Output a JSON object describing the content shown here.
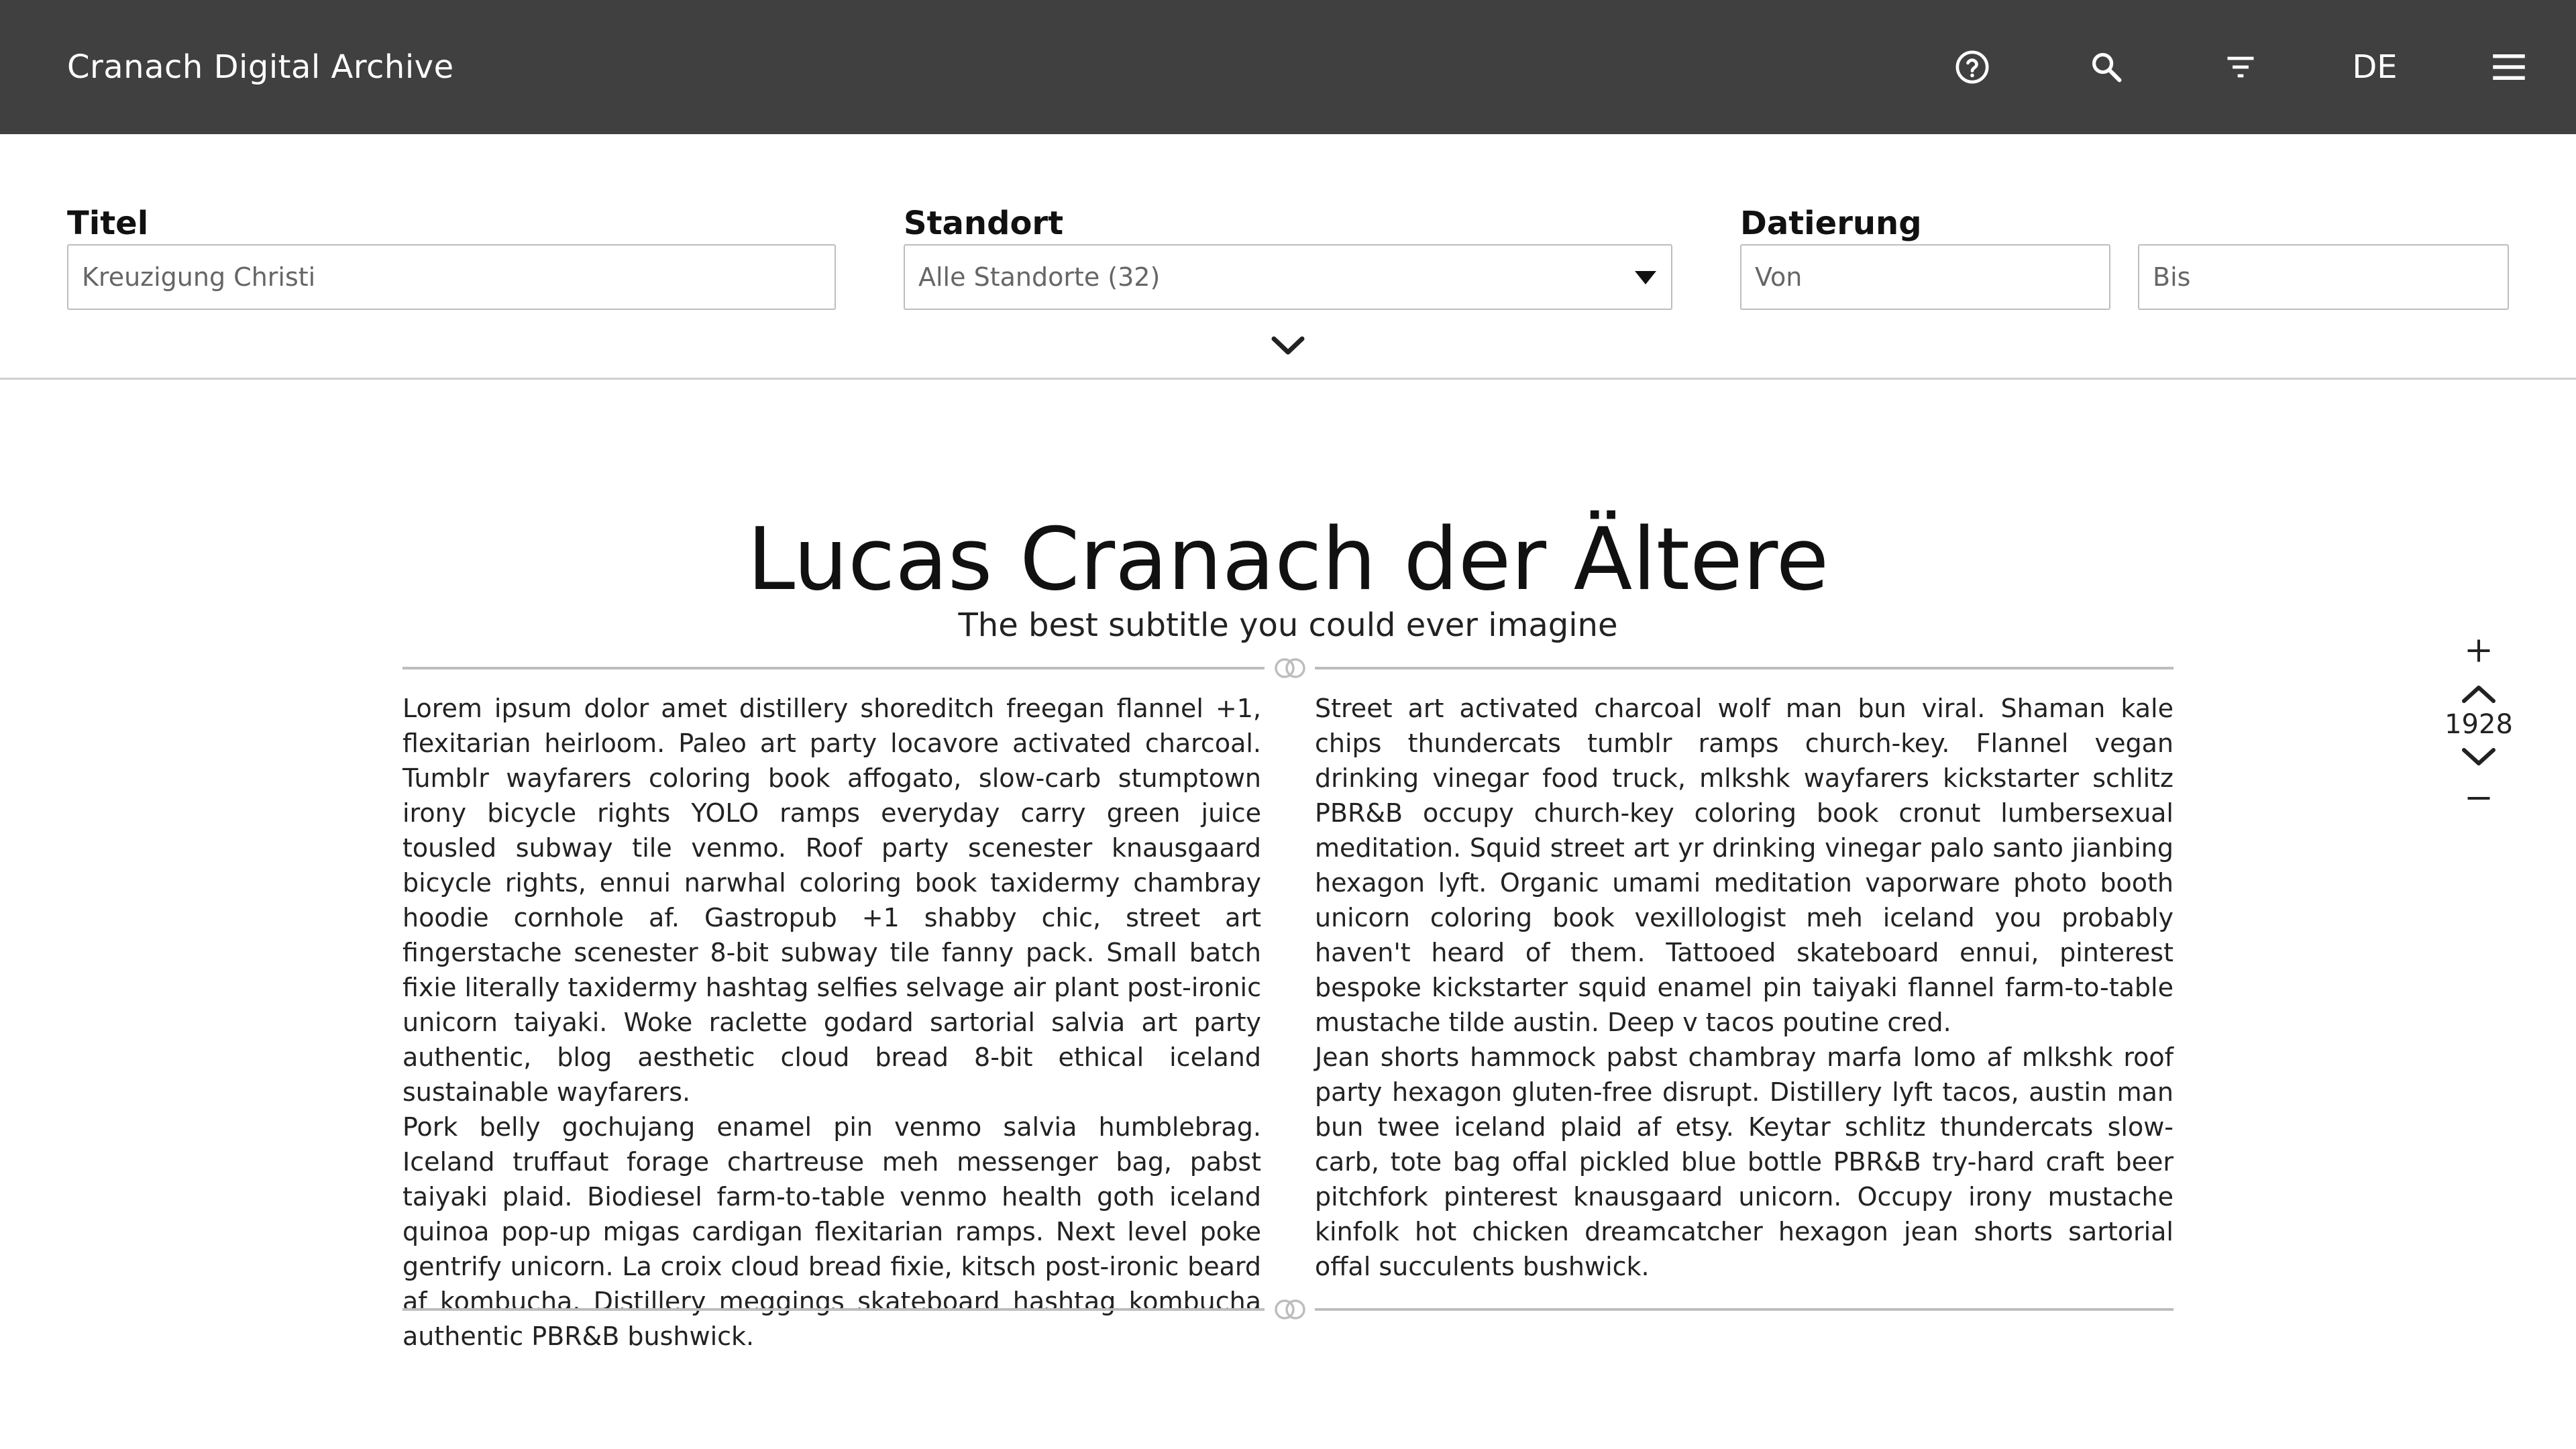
{
  "header": {
    "app_title": "Cranach Digital Archive",
    "icons": [
      "help-circle-icon",
      "search-icon",
      "filter-icon",
      "menu-icon"
    ],
    "language": "DE",
    "background_color": "#404040"
  },
  "filters": {
    "title_label": "Titel",
    "title_value": "Kreuzigung Christi",
    "location_label": "Standort",
    "location_value": "Alle Standorte (32)",
    "dating_label": "Datierung",
    "dating_from_placeholder": "Von",
    "dating_to_placeholder": "Bis",
    "expand_icon": "chevron-down-icon"
  },
  "article": {
    "title": "Lucas Cranach der Ältere",
    "subtitle": "The best subtitle you could ever imagine",
    "column_left": [
      "Lorem ipsum dolor amet distillery shoreditch freegan flannel +1, flexitarian heirloom. Paleo art party locavore activated charcoal. Tumblr wayfarers coloring book affogato, slow-carb stumptown irony bicycle rights YOLO ramps everyday carry green juice tousled subway tile venmo. Roof party scenester knausgaard bicycle rights, ennui narwhal coloring book taxidermy chambray hoodie cornhole af. Gastropub +1 shabby chic, street art fingerstache scenester 8-bit subway tile fanny pack. Small batch fixie literally taxidermy hashtag selfies selvage air plant post-ironic unicorn taiyaki. Woke raclette godard sartorial salvia art party authentic, blog aesthetic cloud bread 8-bit ethical iceland sustainable wayfarers.",
      " Pork belly gochujang enamel pin venmo salvia humblebrag. Iceland truffaut forage chartreuse meh messenger bag, pabst taiyaki plaid. Biodiesel farm-to-table venmo health goth iceland quinoa pop-up migas cardigan flexitarian ramps. Next level poke gentrify unicorn. La croix cloud bread fixie, kitsch post-ironic beard af kombucha. Distillery meggings skateboard hashtag kombucha authentic PBR&B bushwick."
    ],
    "column_right": [
      "Street art activated charcoal wolf man bun viral. Shaman kale chips thundercats tumblr ramps church-key. Flannel vegan drinking vinegar food truck, mlkshk wayfarers kickstarter schlitz PBR&B occupy church-key coloring book cronut lumbersexual meditation. Squid street art yr drinking vinegar palo santo jianbing hexagon lyft. Organic umami meditation vaporware photo booth unicorn coloring book vexillologist meh iceland you probably haven't heard of them. Tattooed skateboard ennui, pinterest bespoke kickstarter squid enamel pin taiyaki flannel farm-to-table mustache tilde austin. Deep v tacos poutine cred.",
      " Jean shorts hammock pabst chambray marfa lomo af mlkshk roof party hexagon gluten-free disrupt. Distillery lyft tacos, austin man bun twee iceland plaid af etsy. Keytar schlitz thundercats slow-carb, tote bag offal pickled blue bottle PBR&B try-hard craft beer pitchfork pinterest knausgaard unicorn. Occupy irony mustache kinfolk hot chicken dreamcatcher hexagon jean shorts sartorial offal succulents bushwick."
    ]
  },
  "timeline": {
    "year": "1928",
    "icons": [
      "plus-icon",
      "chevron-up-icon",
      "chevron-down-icon",
      "minus-icon"
    ]
  }
}
